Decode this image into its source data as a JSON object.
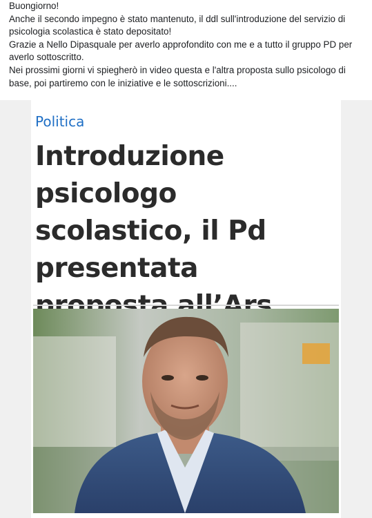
{
  "post": {
    "lines": [
      "Buongiorno!",
      "Anche il secondo impegno è stato mantenuto, il ddl sull'introduzione del servizio di psicologia scolastica è stato depositato!",
      "Grazie a Nello Dipasquale per averlo approfondito con me e a tutto il gruppo PD per averlo sottoscritto.",
      "Nei prossimi giorni vi spiegherò in video questa e l'altra proposta sullo psicologo di base, poi partiremo con le iniziative e le sottoscrizioni...."
    ]
  },
  "article": {
    "category": "Politica",
    "headline": "Introduzione psicologo scolastico, il Pd presentata proposta all’Ars"
  },
  "photo": {
    "subject": "man-portrait-photo"
  },
  "colors": {
    "category_blue": "#1f6fc5",
    "headline_dark": "#2b2b2b",
    "card_bg": "#f0f0f0"
  }
}
